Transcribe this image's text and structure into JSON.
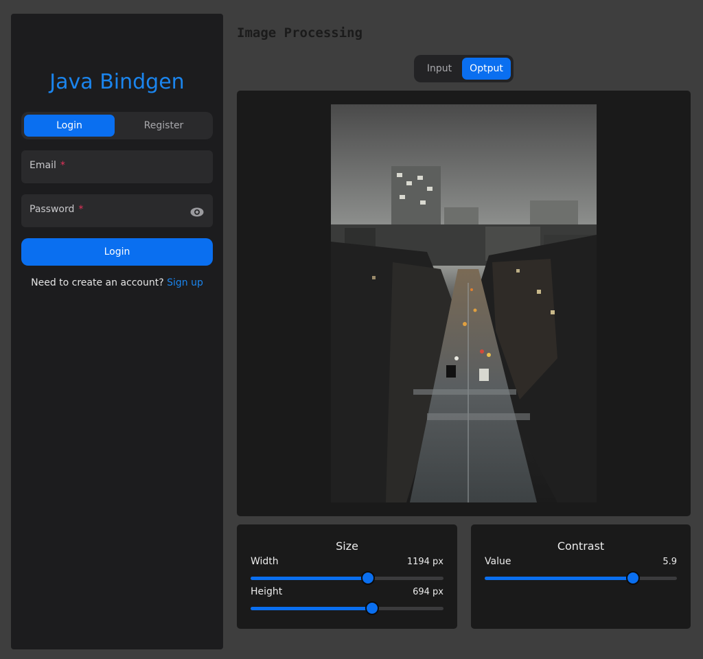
{
  "sidebar": {
    "app_title": "Java Bindgen",
    "tabs": {
      "login": "Login",
      "register": "Register",
      "active": "login"
    },
    "email": {
      "label": "Email",
      "required_mark": "*"
    },
    "password": {
      "label": "Password",
      "required_mark": "*"
    },
    "login_button": "Login",
    "signup_prompt": "Need to create an account?",
    "signup_link": "Sign up"
  },
  "main": {
    "title": "Image Processing",
    "toggle": {
      "input": "Input",
      "output": "Optput",
      "active": "output"
    },
    "image": {
      "description": "night-city-street-photo"
    },
    "size_card": {
      "title": "Size",
      "width": {
        "label": "Width",
        "value_text": "1194 px",
        "fraction": 0.61
      },
      "height": {
        "label": "Height",
        "value_text": "694 px",
        "fraction": 0.63
      }
    },
    "contrast_card": {
      "title": "Contrast",
      "value": {
        "label": "Value",
        "value_text": "5.9",
        "fraction": 0.77
      }
    }
  },
  "colors": {
    "accent": "#0a6ff0",
    "title_blue": "#1b85ee",
    "required": "#e4325a",
    "panel": "#1c1c1e",
    "background": "#3e3e3e"
  }
}
